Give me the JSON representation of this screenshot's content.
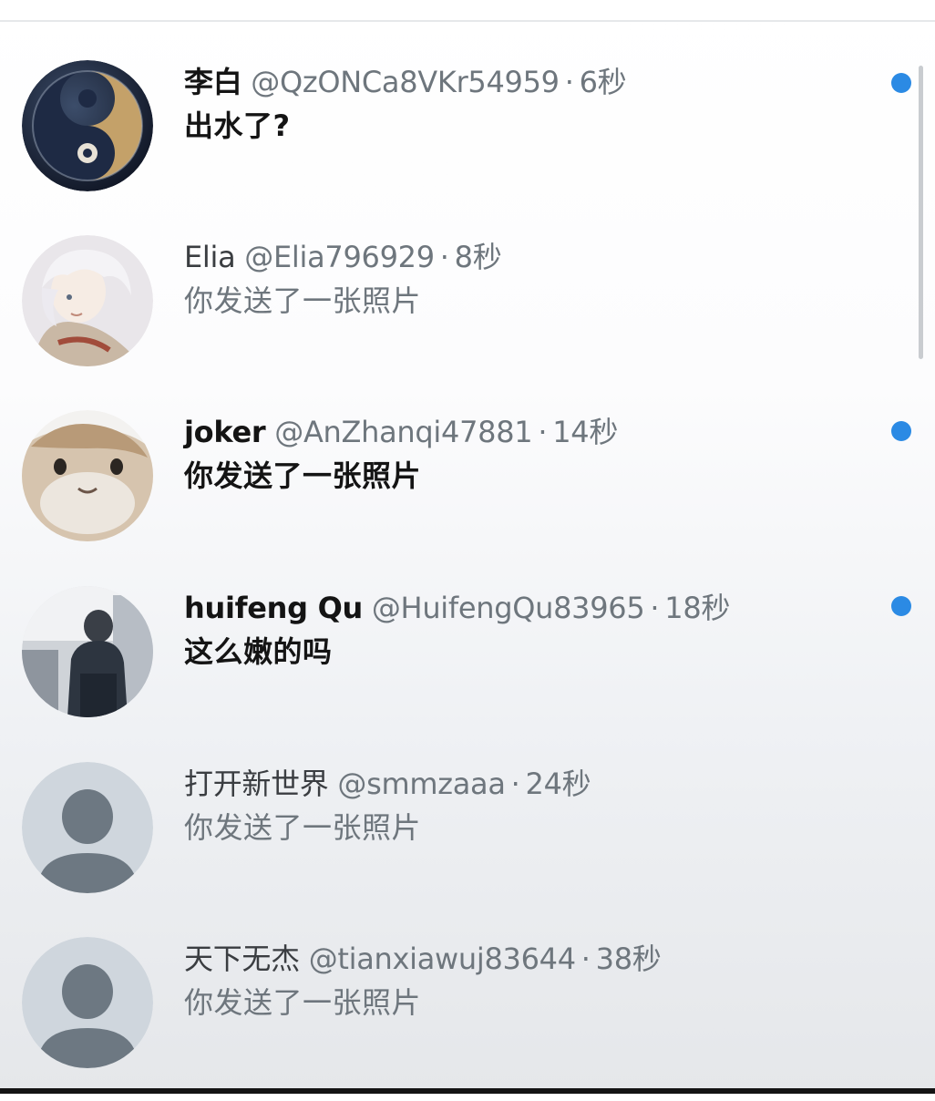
{
  "conversations": [
    {
      "name": "李白",
      "handle": "@QzONCa8VKr54959",
      "separator": "·",
      "time": "6秒",
      "preview": "出水了?",
      "unread": true,
      "avatar": "yin-yang-avatar"
    },
    {
      "name": "Elia",
      "handle": "@Elia796929",
      "separator": "·",
      "time": "8秒",
      "preview": "你发送了一张照片",
      "unread": false,
      "avatar": "anime-character-avatar"
    },
    {
      "name": "joker",
      "handle": "@AnZhanqi47881",
      "separator": "·",
      "time": "14秒",
      "preview": "你发送了一张照片",
      "unread": true,
      "avatar": "cat-face-avatar"
    },
    {
      "name": "huifeng Qu",
      "handle": "@HuifengQu83965",
      "separator": "·",
      "time": "18秒",
      "preview": "这么嫩的吗",
      "unread": true,
      "avatar": "photo-avatar"
    },
    {
      "name": "打开新世界",
      "handle": "@smmzaaa",
      "separator": "·",
      "time": "24秒",
      "preview": "你发送了一张照片",
      "unread": false,
      "avatar": "default-user-avatar"
    },
    {
      "name": "天下无杰",
      "handle": "@tianxiawuj83644",
      "separator": "·",
      "time": "38秒",
      "preview": "你发送了一张照片",
      "unread": false,
      "avatar": "default-user-avatar"
    }
  ],
  "colors": {
    "unread_dot": "#2b8ae4",
    "secondary_text": "#6e767d",
    "default_avatar_bg": "#cfd6dd",
    "default_avatar_fg": "#6d7882"
  }
}
